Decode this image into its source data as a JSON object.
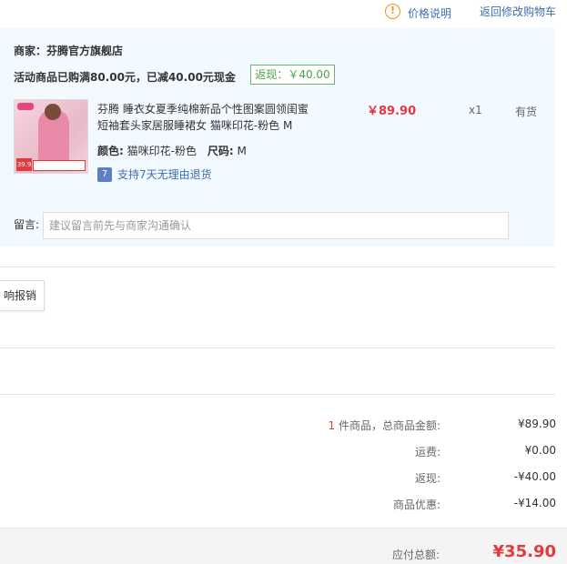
{
  "header": {
    "info_icon": "!",
    "price_help": "价格说明",
    "back_to_cart": "返回修改购物车"
  },
  "shop": {
    "name": "商家：芬腾官方旗舰店",
    "promo": "活动商品已购满80.00元，已减40.00元现金",
    "rebate_tag": "返现：￥40.00"
  },
  "product": {
    "thumb_badge": "39.9",
    "title": "芬腾 睡衣女夏季纯棉新品个性图案圆领闺蜜短袖套头家居服睡裙女 猫咪印花-粉色 M",
    "price": "￥89.90",
    "quantity": "x1",
    "stock": "有货",
    "color_label": "颜色:",
    "color_value": "猫咪印花-粉色",
    "size_label": "尺码:",
    "size_value": "M",
    "return_icon": "7",
    "return_policy": "支持7天无理由退货"
  },
  "remark": {
    "label": "留言:",
    "placeholder": "建议留言前先与商家沟通确认"
  },
  "invoice": {
    "button_label": "响报销"
  },
  "summary": {
    "items_count": "1",
    "items_label": " 件商品，总商品金额:",
    "items_value": "¥89.90",
    "shipping_label": "运费:",
    "shipping_value": "¥0.00",
    "rebate_label": "返现:",
    "rebate_value": "-¥40.00",
    "discount_label": "商品优惠:",
    "discount_value": "-¥14.00",
    "total_label": "应付总额:",
    "total_value": "¥35.90"
  },
  "colors": {
    "accent_red": "#e4393c",
    "link_blue": "#3c6fb1",
    "shop_bg": "#f2f9ff",
    "rebate_green": "#4aa34a"
  }
}
